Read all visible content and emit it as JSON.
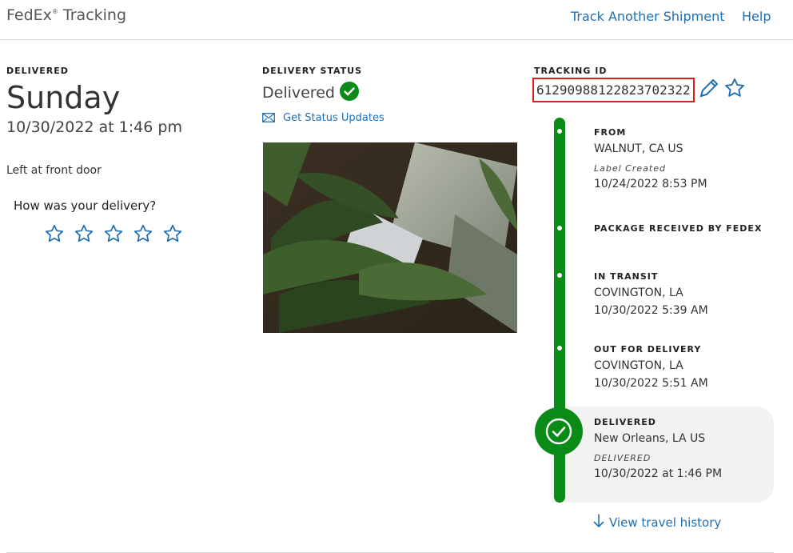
{
  "header": {
    "brand": "FedEx",
    "brand_reg": "®",
    "brand_suffix": " Tracking",
    "track_another": "Track Another Shipment",
    "help": "Help"
  },
  "delivered_block": {
    "label": "DELIVERED",
    "day": "Sunday",
    "datetime": "10/30/2022 at 1:46 pm",
    "note": "Left at front door",
    "rating_prompt": "How was your delivery?",
    "rating_stars": 5
  },
  "delivery_status": {
    "label": "DELIVERY STATUS",
    "status": "Delivered",
    "updates_link": "Get Status Updates"
  },
  "tracking": {
    "label": "TRACKING ID",
    "id": "612909881228237 02322",
    "id_text": "612909881228237023 22"
  },
  "events": [
    {
      "title": "FROM",
      "line1": "WALNUT, CA US",
      "sub": "Label Created",
      "line2": "10/24/2022 8:53 PM"
    },
    {
      "title": "PACKAGE RECEIVED BY FEDEX"
    },
    {
      "title": "IN TRANSIT",
      "line1": "COVINGTON, LA",
      "line2": "10/30/2022 5:39 AM"
    },
    {
      "title": "OUT FOR DELIVERY",
      "line1": "COVINGTON, LA",
      "line2": "10/30/2022 5:51 AM"
    },
    {
      "title": "DELIVERED",
      "line1": "New Orleans, LA US",
      "sub": "DELIVERED",
      "line2": "10/30/2022 at 1:46 PM"
    }
  ],
  "travel_history_link": "View travel history",
  "colors": {
    "brand_blue": "#1f6fb2",
    "success_green": "#0a8a16",
    "highlight_red": "#d92020"
  }
}
